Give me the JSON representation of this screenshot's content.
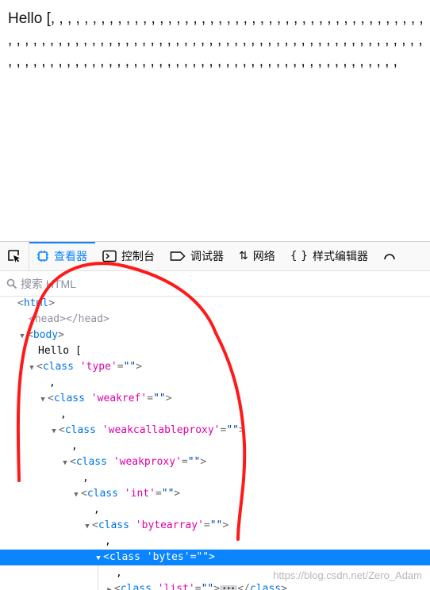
{
  "page": {
    "content": "Hello [, , , , , , , , , , , , , , , , , , , , , , , , , , , , , , , , , , , , , , , , , , , , , , , , , , , , , , , , , , , , , , , , , , , , , , , , , , , , , , , , , , , , , , , , , , , , , , , , , , , , , , , , , , , , , , , , , , , , , , , , , , , , , , , , , , , , , , , , , , , , , ,"
  },
  "toolbar": {
    "tabs": [
      {
        "label": "查看器",
        "icon": "inspector-icon"
      },
      {
        "label": "控制台",
        "icon": "console-icon"
      },
      {
        "label": "调试器",
        "icon": "debugger-icon"
      },
      {
        "label": "网络",
        "icon": "network-icon"
      },
      {
        "label": "样式编辑器",
        "icon": "style-editor-icon"
      }
    ]
  },
  "search": {
    "placeholder": "搜索 HTML"
  },
  "tree": {
    "html": "html",
    "head": "head",
    "body": "body",
    "text_hello": "Hello [",
    "comma": ",",
    "kw_class": "class",
    "classes": [
      "'type'",
      "'weakref'",
      "'weakcallableproxy'",
      "'weakproxy'",
      "'int'",
      "'bytearray'",
      "'bytes'",
      "'list'"
    ],
    "eq": "=",
    "empty_val": "\"\""
  },
  "colors": {
    "selection": "#0a84ff",
    "tag": "#0074e8",
    "attribute": "#dd00a9",
    "value": "#003eaa",
    "annotation": "#ff1a1a"
  },
  "watermark": "https://blog.csdn.net/Zero_Adam"
}
